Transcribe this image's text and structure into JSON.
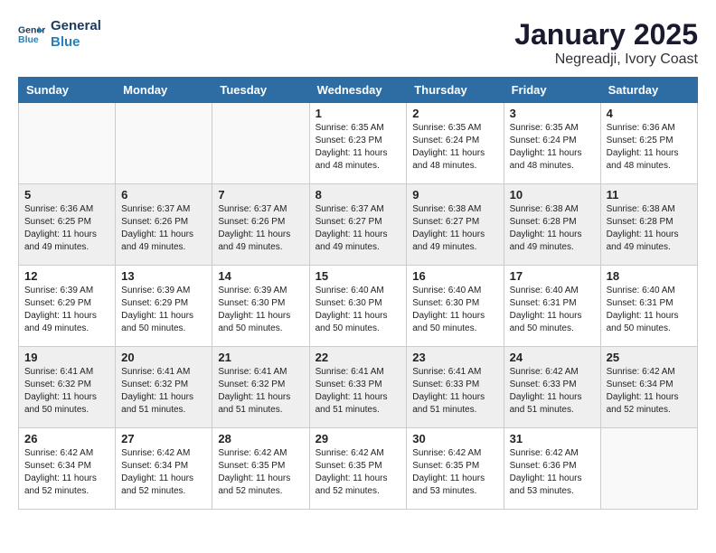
{
  "header": {
    "logo_line1": "General",
    "logo_line2": "Blue",
    "title": "January 2025",
    "subtitle": "Negreadji, Ivory Coast"
  },
  "days_of_week": [
    "Sunday",
    "Monday",
    "Tuesday",
    "Wednesday",
    "Thursday",
    "Friday",
    "Saturday"
  ],
  "weeks": [
    [
      {
        "day": "",
        "info": ""
      },
      {
        "day": "",
        "info": ""
      },
      {
        "day": "",
        "info": ""
      },
      {
        "day": "1",
        "info": "Sunrise: 6:35 AM\nSunset: 6:23 PM\nDaylight: 11 hours\nand 48 minutes."
      },
      {
        "day": "2",
        "info": "Sunrise: 6:35 AM\nSunset: 6:24 PM\nDaylight: 11 hours\nand 48 minutes."
      },
      {
        "day": "3",
        "info": "Sunrise: 6:35 AM\nSunset: 6:24 PM\nDaylight: 11 hours\nand 48 minutes."
      },
      {
        "day": "4",
        "info": "Sunrise: 6:36 AM\nSunset: 6:25 PM\nDaylight: 11 hours\nand 48 minutes."
      }
    ],
    [
      {
        "day": "5",
        "info": "Sunrise: 6:36 AM\nSunset: 6:25 PM\nDaylight: 11 hours\nand 49 minutes."
      },
      {
        "day": "6",
        "info": "Sunrise: 6:37 AM\nSunset: 6:26 PM\nDaylight: 11 hours\nand 49 minutes."
      },
      {
        "day": "7",
        "info": "Sunrise: 6:37 AM\nSunset: 6:26 PM\nDaylight: 11 hours\nand 49 minutes."
      },
      {
        "day": "8",
        "info": "Sunrise: 6:37 AM\nSunset: 6:27 PM\nDaylight: 11 hours\nand 49 minutes."
      },
      {
        "day": "9",
        "info": "Sunrise: 6:38 AM\nSunset: 6:27 PM\nDaylight: 11 hours\nand 49 minutes."
      },
      {
        "day": "10",
        "info": "Sunrise: 6:38 AM\nSunset: 6:28 PM\nDaylight: 11 hours\nand 49 minutes."
      },
      {
        "day": "11",
        "info": "Sunrise: 6:38 AM\nSunset: 6:28 PM\nDaylight: 11 hours\nand 49 minutes."
      }
    ],
    [
      {
        "day": "12",
        "info": "Sunrise: 6:39 AM\nSunset: 6:29 PM\nDaylight: 11 hours\nand 49 minutes."
      },
      {
        "day": "13",
        "info": "Sunrise: 6:39 AM\nSunset: 6:29 PM\nDaylight: 11 hours\nand 50 minutes."
      },
      {
        "day": "14",
        "info": "Sunrise: 6:39 AM\nSunset: 6:30 PM\nDaylight: 11 hours\nand 50 minutes."
      },
      {
        "day": "15",
        "info": "Sunrise: 6:40 AM\nSunset: 6:30 PM\nDaylight: 11 hours\nand 50 minutes."
      },
      {
        "day": "16",
        "info": "Sunrise: 6:40 AM\nSunset: 6:30 PM\nDaylight: 11 hours\nand 50 minutes."
      },
      {
        "day": "17",
        "info": "Sunrise: 6:40 AM\nSunset: 6:31 PM\nDaylight: 11 hours\nand 50 minutes."
      },
      {
        "day": "18",
        "info": "Sunrise: 6:40 AM\nSunset: 6:31 PM\nDaylight: 11 hours\nand 50 minutes."
      }
    ],
    [
      {
        "day": "19",
        "info": "Sunrise: 6:41 AM\nSunset: 6:32 PM\nDaylight: 11 hours\nand 50 minutes."
      },
      {
        "day": "20",
        "info": "Sunrise: 6:41 AM\nSunset: 6:32 PM\nDaylight: 11 hours\nand 51 minutes."
      },
      {
        "day": "21",
        "info": "Sunrise: 6:41 AM\nSunset: 6:32 PM\nDaylight: 11 hours\nand 51 minutes."
      },
      {
        "day": "22",
        "info": "Sunrise: 6:41 AM\nSunset: 6:33 PM\nDaylight: 11 hours\nand 51 minutes."
      },
      {
        "day": "23",
        "info": "Sunrise: 6:41 AM\nSunset: 6:33 PM\nDaylight: 11 hours\nand 51 minutes."
      },
      {
        "day": "24",
        "info": "Sunrise: 6:42 AM\nSunset: 6:33 PM\nDaylight: 11 hours\nand 51 minutes."
      },
      {
        "day": "25",
        "info": "Sunrise: 6:42 AM\nSunset: 6:34 PM\nDaylight: 11 hours\nand 52 minutes."
      }
    ],
    [
      {
        "day": "26",
        "info": "Sunrise: 6:42 AM\nSunset: 6:34 PM\nDaylight: 11 hours\nand 52 minutes."
      },
      {
        "day": "27",
        "info": "Sunrise: 6:42 AM\nSunset: 6:34 PM\nDaylight: 11 hours\nand 52 minutes."
      },
      {
        "day": "28",
        "info": "Sunrise: 6:42 AM\nSunset: 6:35 PM\nDaylight: 11 hours\nand 52 minutes."
      },
      {
        "day": "29",
        "info": "Sunrise: 6:42 AM\nSunset: 6:35 PM\nDaylight: 11 hours\nand 52 minutes."
      },
      {
        "day": "30",
        "info": "Sunrise: 6:42 AM\nSunset: 6:35 PM\nDaylight: 11 hours\nand 53 minutes."
      },
      {
        "day": "31",
        "info": "Sunrise: 6:42 AM\nSunset: 6:36 PM\nDaylight: 11 hours\nand 53 minutes."
      },
      {
        "day": "",
        "info": ""
      }
    ]
  ]
}
